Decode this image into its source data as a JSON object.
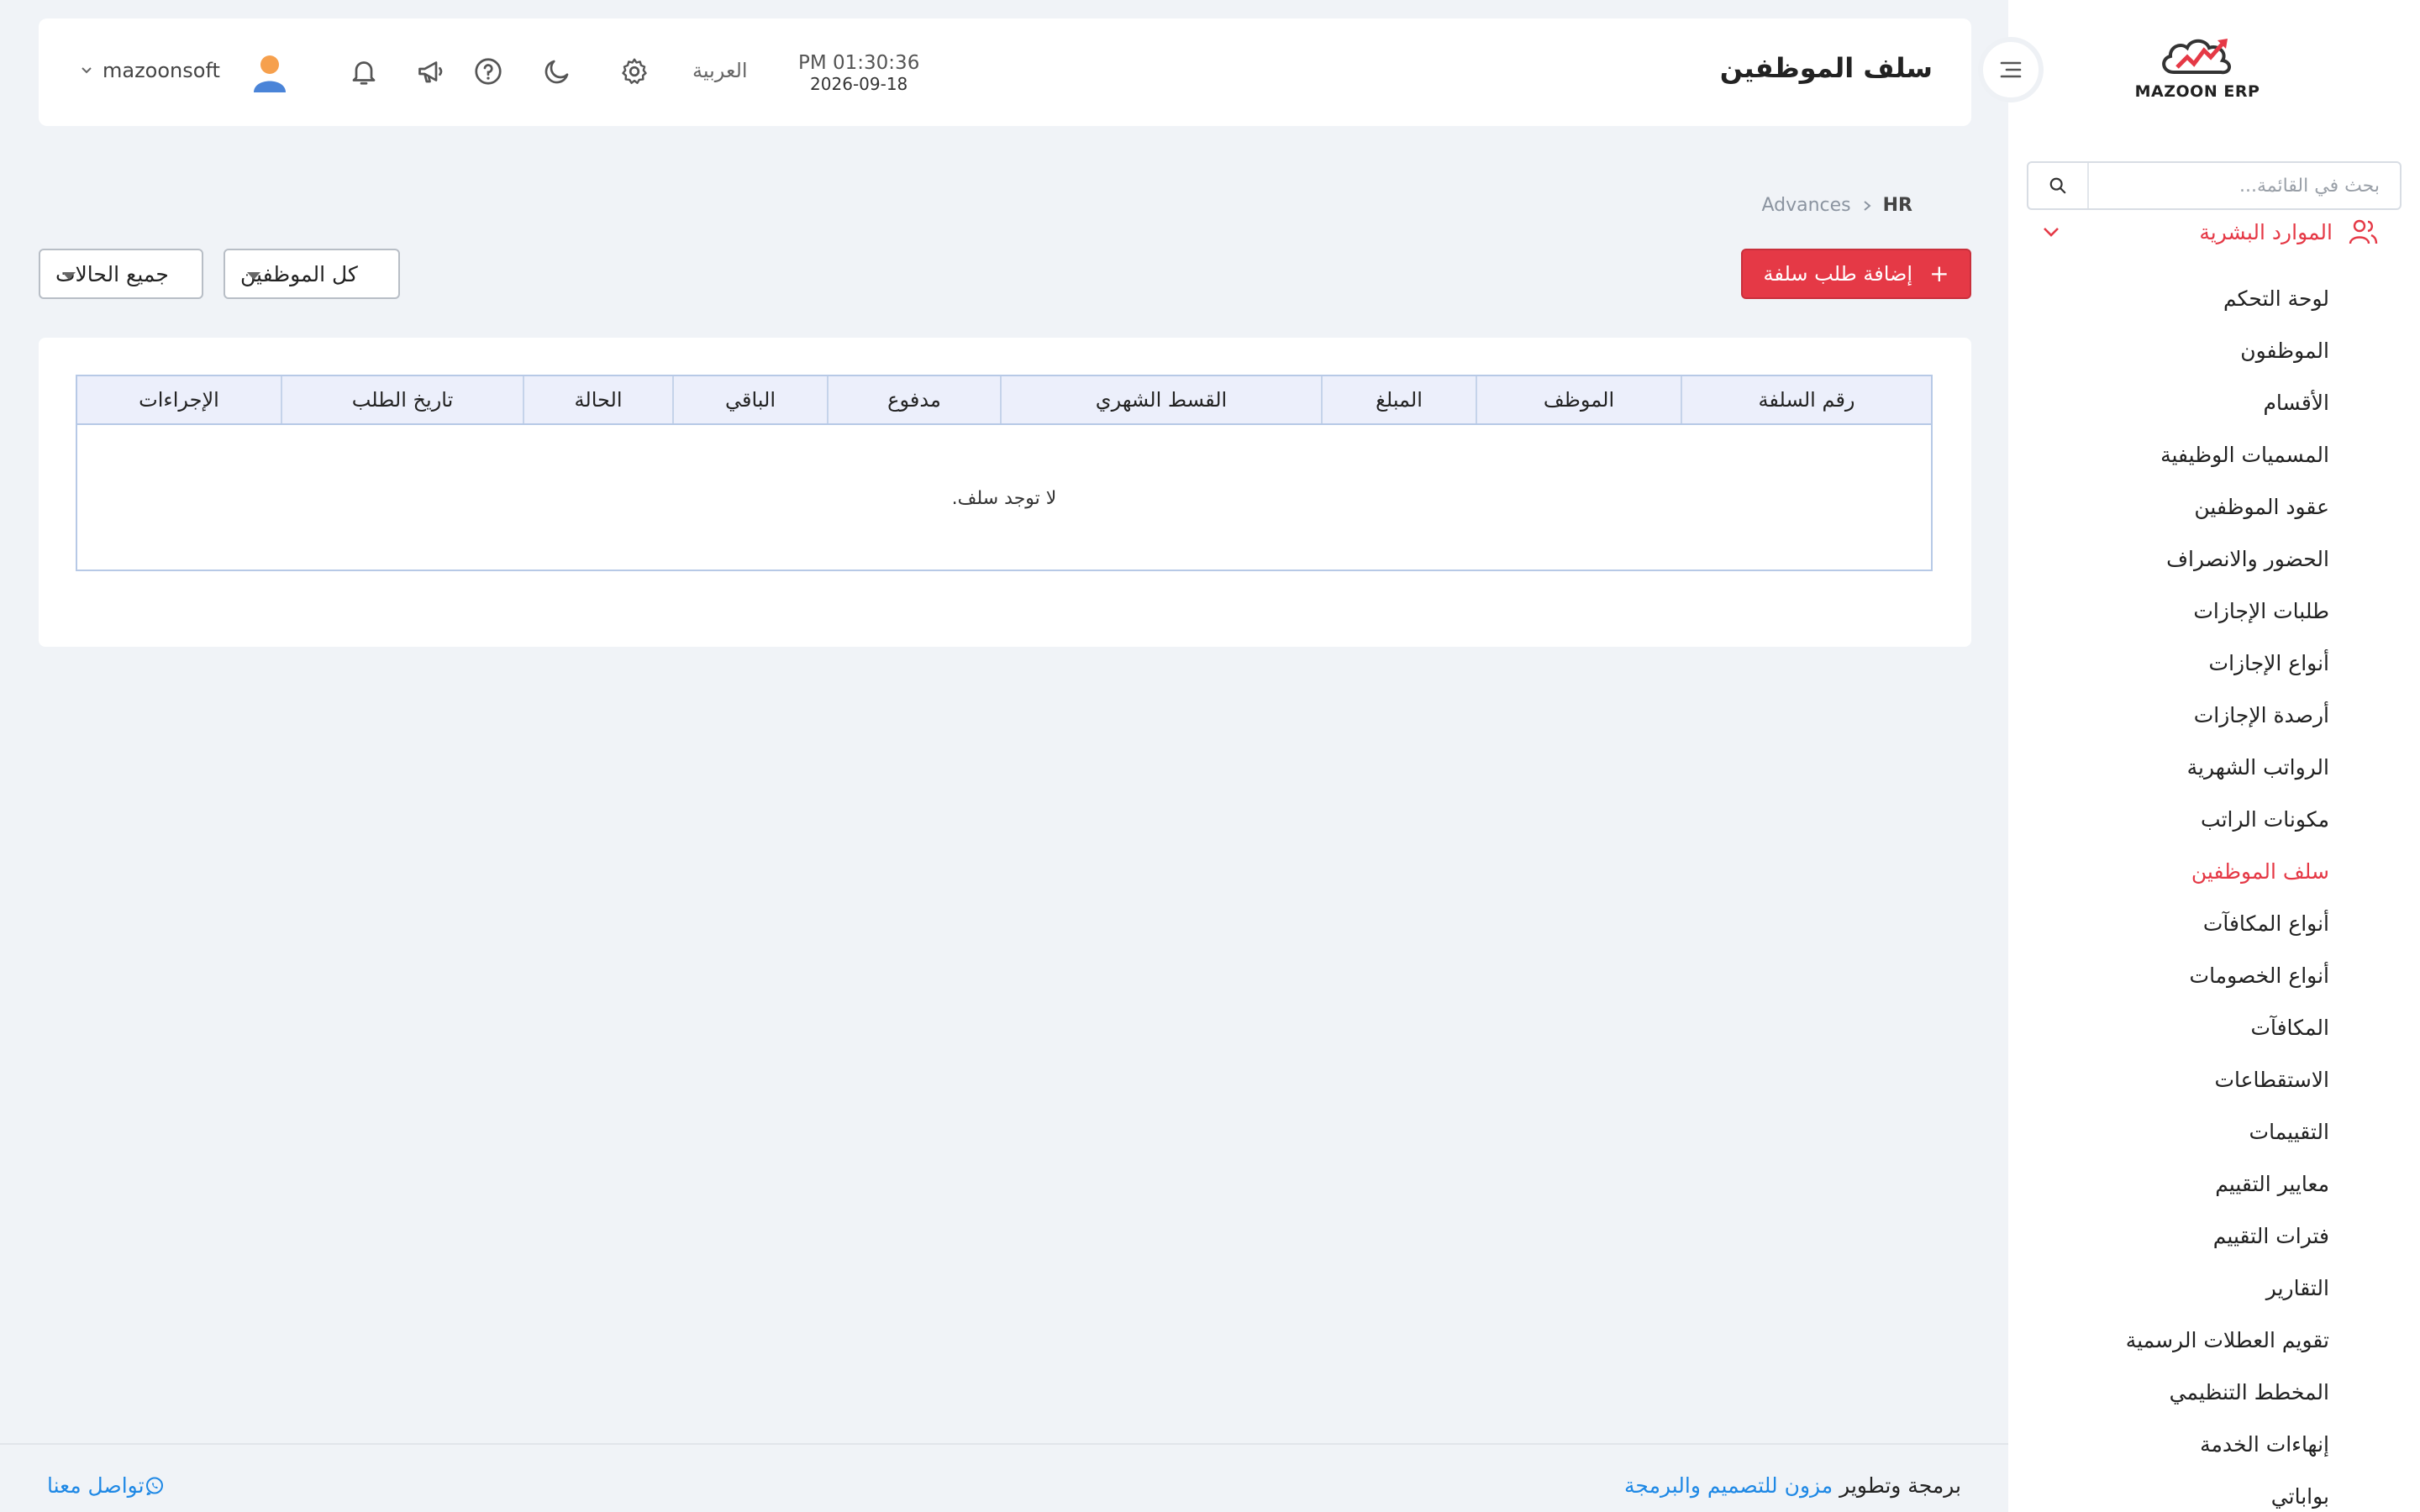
{
  "sidebar": {
    "logo_text": "MAZOON ERP",
    "logo_subtext": "ERP",
    "search_placeholder": "بحث في القائمة...",
    "group_label": "الموارد البشرية",
    "items": [
      {
        "label": "لوحة التحكم",
        "active": false
      },
      {
        "label": "الموظفون",
        "active": false
      },
      {
        "label": "الأقسام",
        "active": false
      },
      {
        "label": "المسميات الوظيفية",
        "active": false
      },
      {
        "label": "عقود الموظفين",
        "active": false
      },
      {
        "label": "الحضور والانصراف",
        "active": false
      },
      {
        "label": "طلبات الإجازات",
        "active": false
      },
      {
        "label": "أنواع الإجازات",
        "active": false
      },
      {
        "label": "أرصدة الإجازات",
        "active": false
      },
      {
        "label": "الرواتب الشهرية",
        "active": false
      },
      {
        "label": "مكونات الراتب",
        "active": false
      },
      {
        "label": "سلف الموظفين",
        "active": true
      },
      {
        "label": "أنواع المكافآت",
        "active": false
      },
      {
        "label": "أنواع الخصومات",
        "active": false
      },
      {
        "label": "المكافآت",
        "active": false
      },
      {
        "label": "الاستقطاعات",
        "active": false
      },
      {
        "label": "التقييمات",
        "active": false
      },
      {
        "label": "معايير التقييم",
        "active": false
      },
      {
        "label": "فترات التقييم",
        "active": false
      },
      {
        "label": "التقارير",
        "active": false
      },
      {
        "label": "تقويم العطلات الرسمية",
        "active": false
      },
      {
        "label": "المخطط التنظيمي",
        "active": false
      },
      {
        "label": "إنهاءات الخدمة",
        "active": false
      },
      {
        "label": "بواباتي",
        "active": false
      }
    ]
  },
  "header": {
    "title": "سلف الموظفين",
    "time": "PM 01:30:36",
    "date": "2026-09-18",
    "language": "العربية",
    "username": "mazoonsoft"
  },
  "breadcrumb": {
    "root": "HR",
    "current": "Advances"
  },
  "toolbar": {
    "add_label": "إضافة طلب سلفة",
    "employees_filter": "كل الموظفين",
    "status_filter": "جميع الحالات"
  },
  "table": {
    "columns": [
      "رقم السلفة",
      "الموظف",
      "المبلغ",
      "القسط الشهري",
      "مدفوع",
      "الباقي",
      "الحالة",
      "تاريخ الطلب",
      "الإجراءات"
    ],
    "empty_text": "لا توجد سلف."
  },
  "footer": {
    "credit_prefix": "برمجة وتطوير",
    "credit_link": "مزون للتصميم والبرمجة",
    "contact_label": "تواصل معنا"
  },
  "colors": {
    "accent": "#e53946",
    "link": "#1e88e5",
    "background": "#f0f3f7"
  }
}
